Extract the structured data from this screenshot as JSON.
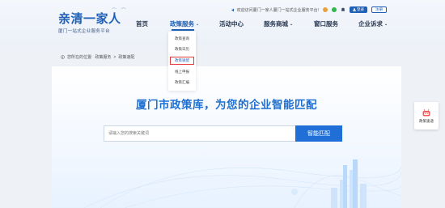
{
  "logo": {
    "title": "亲清一家人",
    "subtitle": "厦门一站式企业服务平台"
  },
  "topbar": {
    "welcome": "欢迎访问厦门一家人厦门一站式企业服务平台!",
    "login": "登录",
    "register": "注册",
    "icons": [
      "speaker-icon",
      "weibo-icon",
      "wechat-icon",
      "bell-icon"
    ]
  },
  "nav": {
    "items": [
      {
        "label": "首页"
      },
      {
        "label": "政策服务",
        "active": true,
        "caret": "⌄"
      },
      {
        "label": "活动中心"
      },
      {
        "label": "服务商城",
        "caret": "⌄"
      },
      {
        "label": "窗口服务"
      },
      {
        "label": "企业诉求",
        "caret": "⌄"
      }
    ]
  },
  "dropdown": {
    "items": [
      {
        "label": "政策查询"
      },
      {
        "label": "政策日历"
      },
      {
        "label": "政策速配",
        "highlighted": true
      },
      {
        "label": "线上申报"
      },
      {
        "label": "政策汇编"
      }
    ]
  },
  "breadcrumb": {
    "prefix": "您所在的位置:",
    "level1": "政策服务",
    "separator": ">",
    "level2": "政策速配"
  },
  "main": {
    "title": "厦门市政策库，为您的企业智能匹配",
    "search_placeholder": "请输入您的搜索关键词",
    "search_button": "智能匹配"
  },
  "float_widget": {
    "label": "政策速递"
  },
  "colors": {
    "primary": "#1f5fb5",
    "accent": "#1e6fd1",
    "highlight_border": "#e33b3b"
  }
}
